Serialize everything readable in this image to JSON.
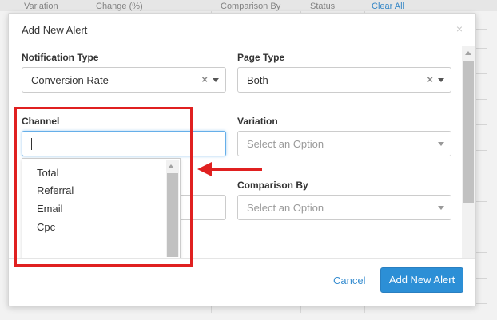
{
  "background": {
    "columns": [
      "Variation",
      "Change (%)",
      "Comparison By",
      "Status",
      "Clear All"
    ]
  },
  "modal": {
    "title": "Add New Alert",
    "close_glyph": "×"
  },
  "fields": {
    "notification_type": {
      "label": "Notification Type",
      "value": "Conversion Rate",
      "clear_glyph": "×"
    },
    "page_type": {
      "label": "Page Type",
      "value": "Both",
      "clear_glyph": "×"
    },
    "channel": {
      "label": "Channel",
      "value": ""
    },
    "variation": {
      "label": "Variation",
      "placeholder": "Select an Option"
    },
    "comparison_by": {
      "label": "Comparison By",
      "placeholder": "Select an Option"
    }
  },
  "channel_options": [
    "Total",
    "Referral",
    "Email",
    "Cpc"
  ],
  "footer": {
    "cancel_label": "Cancel",
    "submit_label": "Add New Alert"
  },
  "colors": {
    "primary": "#2c8fd6",
    "link": "#3a8fd1",
    "annotation": "#e02020",
    "focus": "#66afe9"
  }
}
